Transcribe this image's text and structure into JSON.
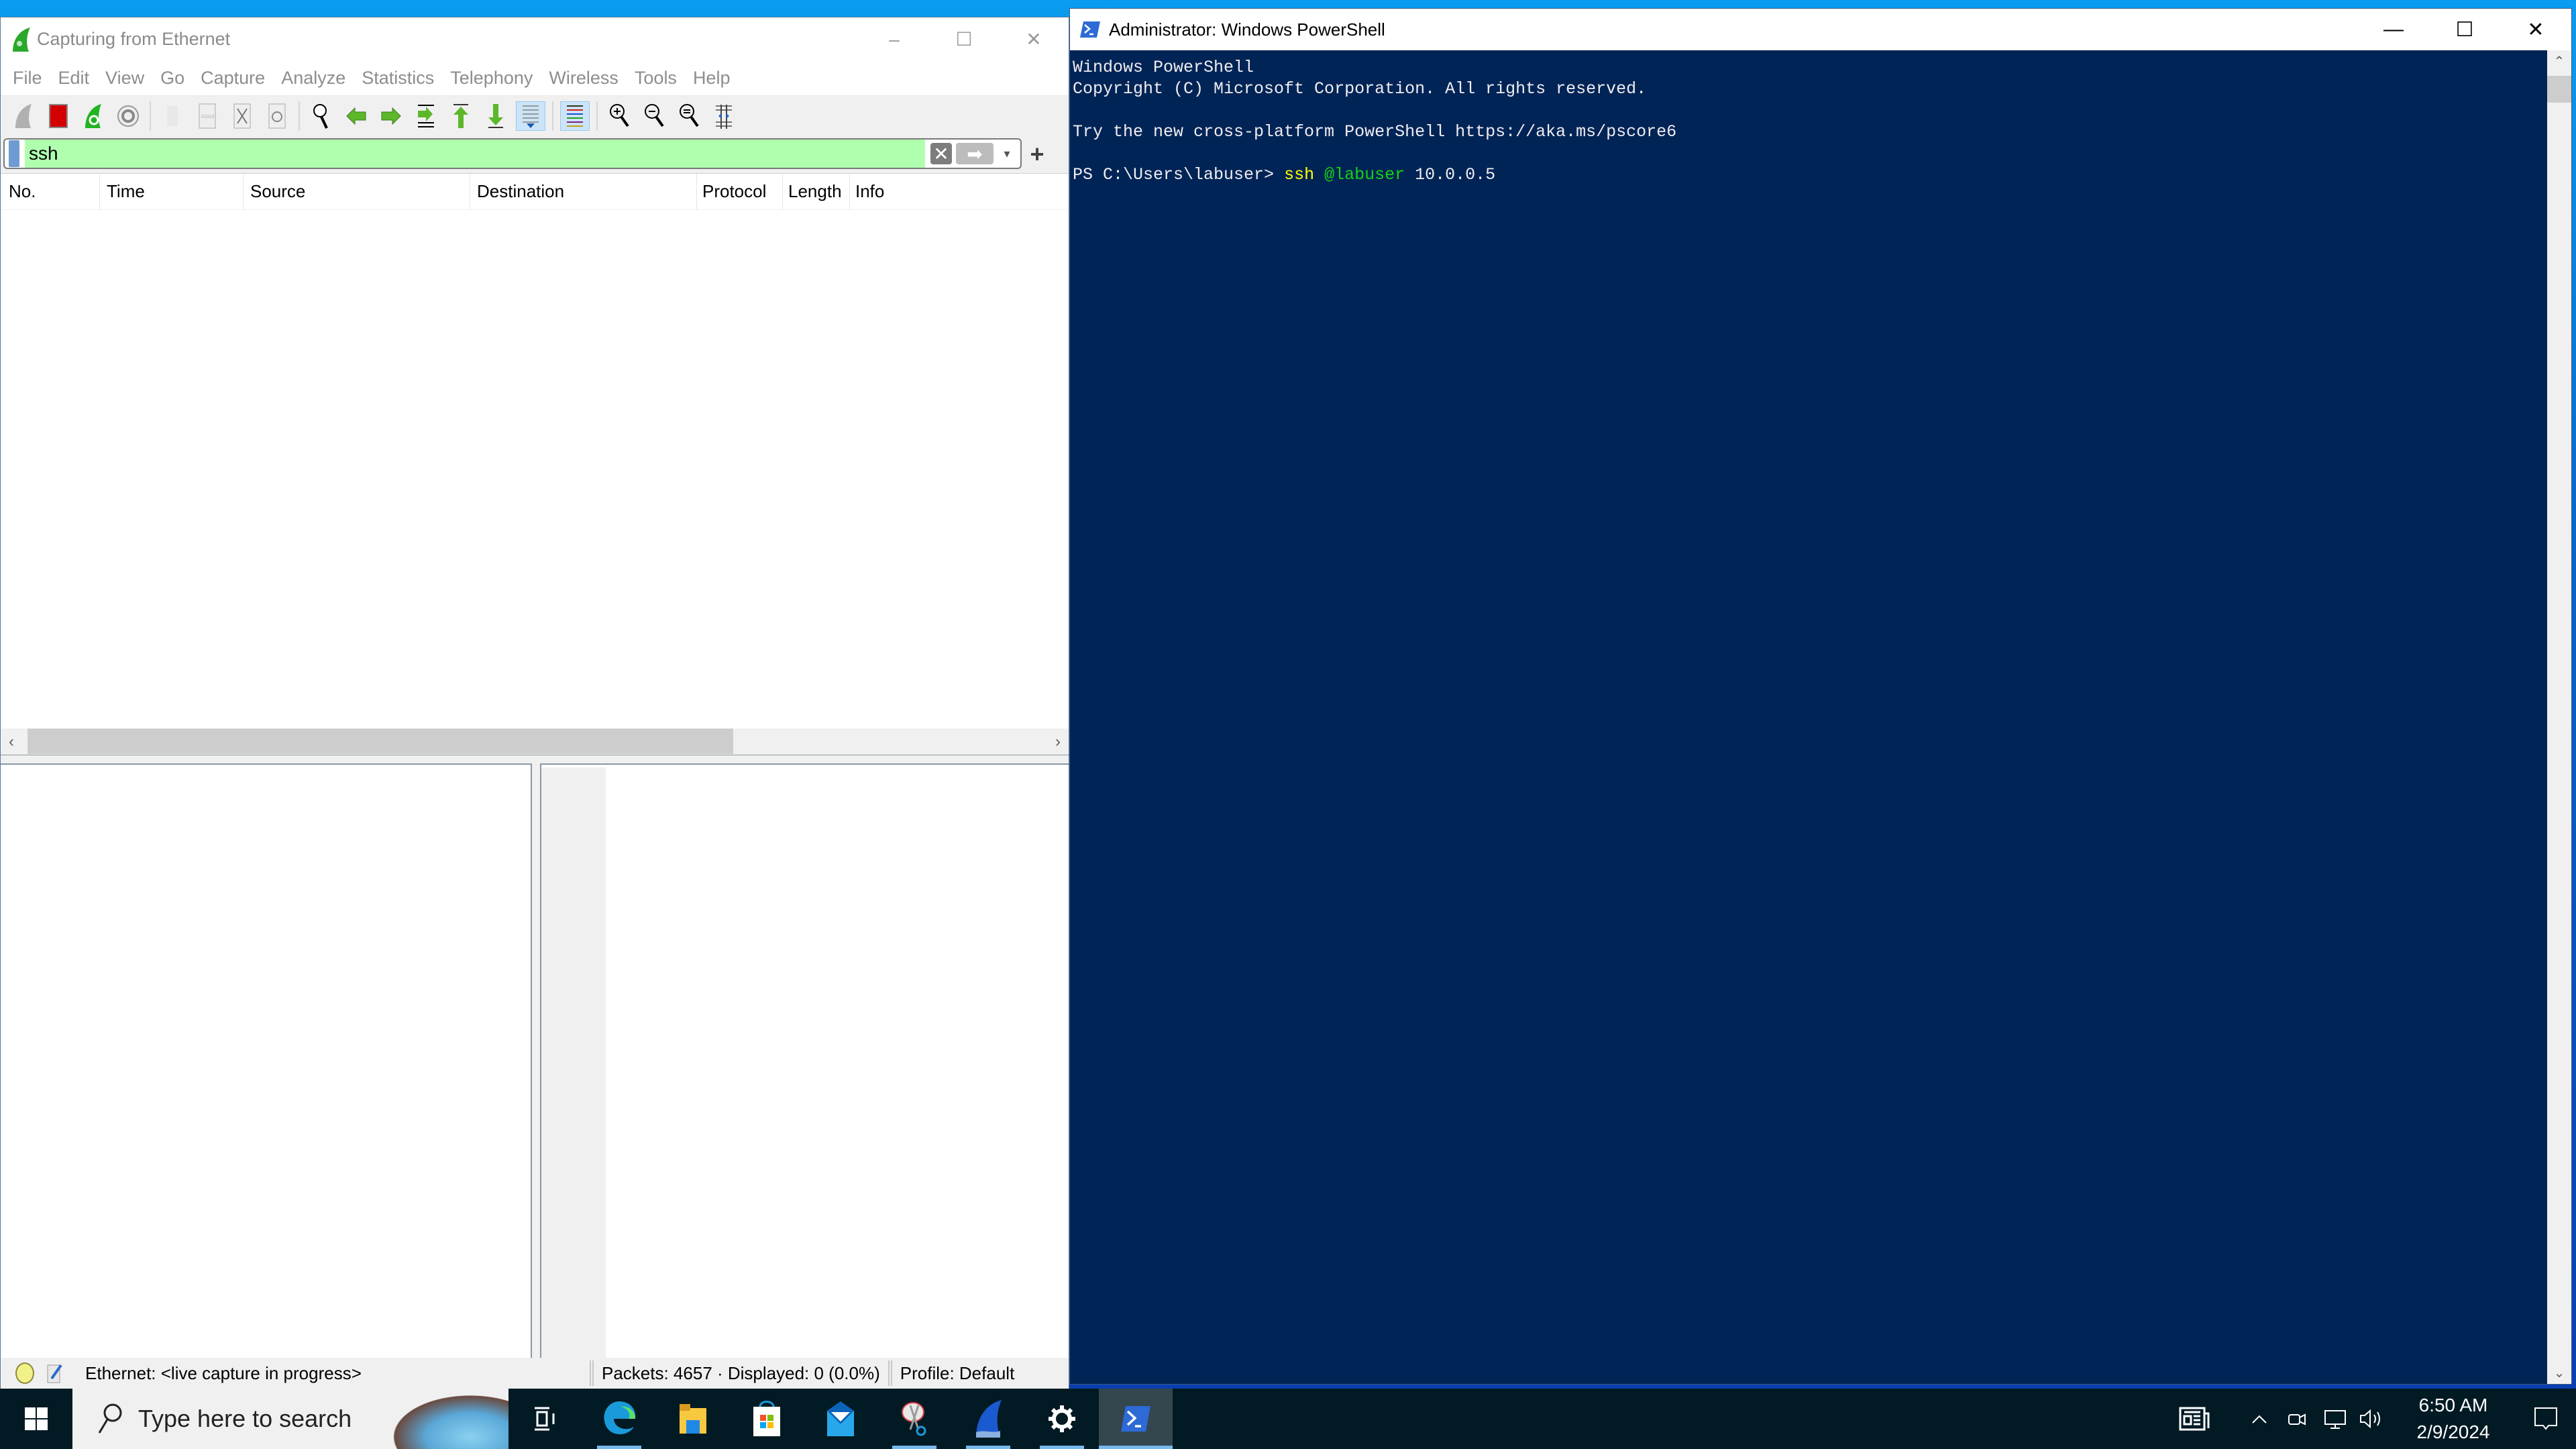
{
  "wireshark": {
    "title": "Capturing from Ethernet",
    "window_buttons": {
      "minimize": "–",
      "maximize": "☐",
      "close": "✕"
    },
    "menu": [
      "File",
      "Edit",
      "View",
      "Go",
      "Capture",
      "Analyze",
      "Statistics",
      "Telephony",
      "Wireless",
      "Tools",
      "Help"
    ],
    "toolbar": [
      "start-capture-icon",
      "stop-capture-icon",
      "restart-capture-icon",
      "capture-options-icon",
      "open-file-icon",
      "save-file-icon",
      "close-file-icon",
      "reload-file-icon",
      "find-packet-icon",
      "go-back-icon",
      "go-forward-icon",
      "go-to-packet-icon",
      "first-packet-icon",
      "last-packet-icon",
      "autoscroll-icon",
      "colorize-icon",
      "zoom-in-icon",
      "zoom-out-icon",
      "normal-size-icon",
      "resize-columns-icon"
    ],
    "filter": {
      "value": "ssh",
      "clear_label": "✕",
      "apply_label": "➡",
      "dropdown_label": "▾",
      "add_label": "+"
    },
    "columns": [
      "No.",
      "Time",
      "Source",
      "Destination",
      "Protocol",
      "Length",
      "Info"
    ],
    "packets": [],
    "status": {
      "interface": "Ethernet: <live capture in progress>",
      "packets": "Packets: 4657 · Displayed: 0 (0.0%)",
      "profile": "Profile: Default"
    },
    "colors": {
      "filter_valid": "#afffaf"
    }
  },
  "powershell": {
    "title": "Administrator: Windows PowerShell",
    "lines": {
      "l1": "Windows PowerShell",
      "l2": "Copyright (C) Microsoft Corporation. All rights reserved.",
      "l3": "Try the new cross-platform PowerShell https://aka.ms/pscore6",
      "prompt": "PS C:\\Users\\labuser> ",
      "cmd": "ssh",
      "arg1": "@labuser",
      "arg2": " 10.0.0.5"
    },
    "colors": {
      "background": "#012456",
      "command": "#ffff00",
      "argument": "#13d313"
    }
  },
  "taskbar": {
    "search_placeholder": "Type here to search",
    "apps": [
      "task-view",
      "edge",
      "file-explorer",
      "microsoft-store",
      "mail",
      "snipping-tool",
      "wireshark",
      "settings",
      "powershell"
    ],
    "clock": {
      "time": "6:50 AM",
      "date": "2/9/2024"
    }
  }
}
